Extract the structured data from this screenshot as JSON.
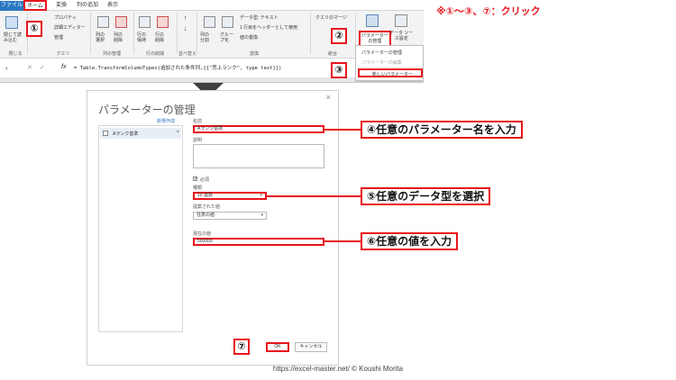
{
  "ribbon": {
    "tabs": [
      "ファイル",
      "ホーム",
      "変換",
      "列の追加",
      "表示"
    ],
    "buttons": {
      "close_load": "閉じて読\nみ込む",
      "properties": "プロパティ",
      "advanced_editor": "詳細エディター",
      "manage": "管理",
      "choose_columns": "列の\n選択",
      "remove_columns": "列の\n削除",
      "keep_rows": "行の\n保持",
      "remove_rows": "行の\n削除",
      "split_column": "列の\n分割",
      "group_by": "グルー\nプ化",
      "data_type": "データ型: テキスト",
      "first_row_header": "1 行目をヘッダーとして使用",
      "replace_values": "値の置換",
      "merge_queries": "クエリのマージ",
      "manage_parameters": "パラメーター\nの管理",
      "data_source": "データ ソー\nス設定"
    },
    "groups": [
      "閉じる",
      "クエリ",
      "列の管理",
      "行の削減",
      "並べ替え",
      "変換",
      "結合",
      "パラメーター"
    ],
    "formula_prefix": "fx",
    "formula_text": "= Table.TransformColumnTypes(追加された条件列,{{\"売上ランク\", type text}})"
  },
  "menu": {
    "items": [
      "パラメーターの管理",
      "パラメーターの編集",
      "新しいパラメーター"
    ]
  },
  "dialog": {
    "title": "パラメーターの管理",
    "close": "×",
    "new_link": "新規作成",
    "list_item": "Aランク基準",
    "list_item_remove": "×",
    "name_label": "名前",
    "name_value": "Aランク基準",
    "desc_label": "説明",
    "required_check": "✓",
    "required_label": "必須",
    "type_label": "種類",
    "type_value": "10 進数",
    "suggested_label": "提案された値",
    "suggested_value": "任意の値",
    "current_label": "現在の値",
    "current_value": "500000",
    "ok": "OK",
    "cancel": "キャンセル"
  },
  "annotations": {
    "note": "※①～③、⑦：クリック",
    "n1": "①",
    "n2": "②",
    "n3": "③",
    "n7": "⑦",
    "c4": "④任意のパラメーター名を入力",
    "c5": "⑤任意のデータ型を選択",
    "c6": "⑥任意の値を入力"
  },
  "credit": "https://excel-master.net/  © Koushi Morita",
  "colors": {
    "accent": "#e8141b",
    "file_tab": "#2b78c2"
  }
}
